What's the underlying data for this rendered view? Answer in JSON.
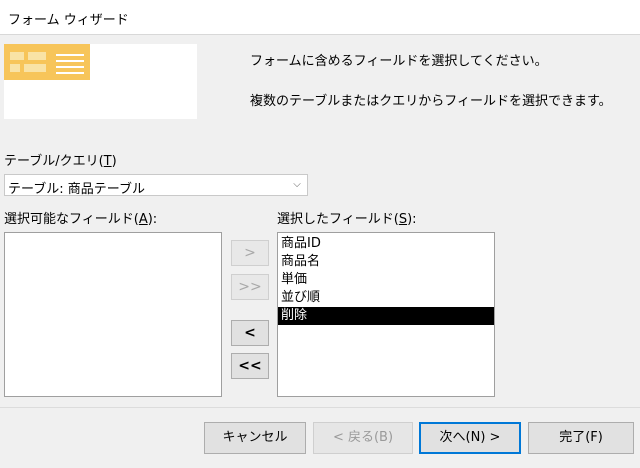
{
  "window": {
    "title": "フォーム ウィザード"
  },
  "instructions": {
    "line1": "フォームに含めるフィールドを選択してください。",
    "line2": "複数のテーブルまたはクエリからフィールドを選択できます。"
  },
  "table_query": {
    "label_pre": "テーブル/クエリ(",
    "label_key": "T",
    "label_post": ")",
    "selected": "テーブル: 商品テーブル"
  },
  "available_fields": {
    "label_pre": "選択可能なフィールド(",
    "label_key": "A",
    "label_post": "):",
    "items": []
  },
  "selected_fields": {
    "label_pre": "選択したフィールド(",
    "label_key": "S",
    "label_post": "):",
    "items": [
      "商品ID",
      "商品名",
      "単価",
      "並び順",
      "削除"
    ],
    "highlighted_index": 4
  },
  "move_buttons": {
    "add_one": ">",
    "add_all": ">>",
    "remove_one": "<",
    "remove_all": "<<"
  },
  "footer": {
    "cancel": "キャンセル",
    "back": "< 戻る(B)",
    "next": "次へ(N) >",
    "finish": "完了(F)"
  },
  "colors": {
    "selection_bg": "#000000",
    "default_button_border": "#0078d7",
    "preview_accent": "#f7c55a"
  }
}
